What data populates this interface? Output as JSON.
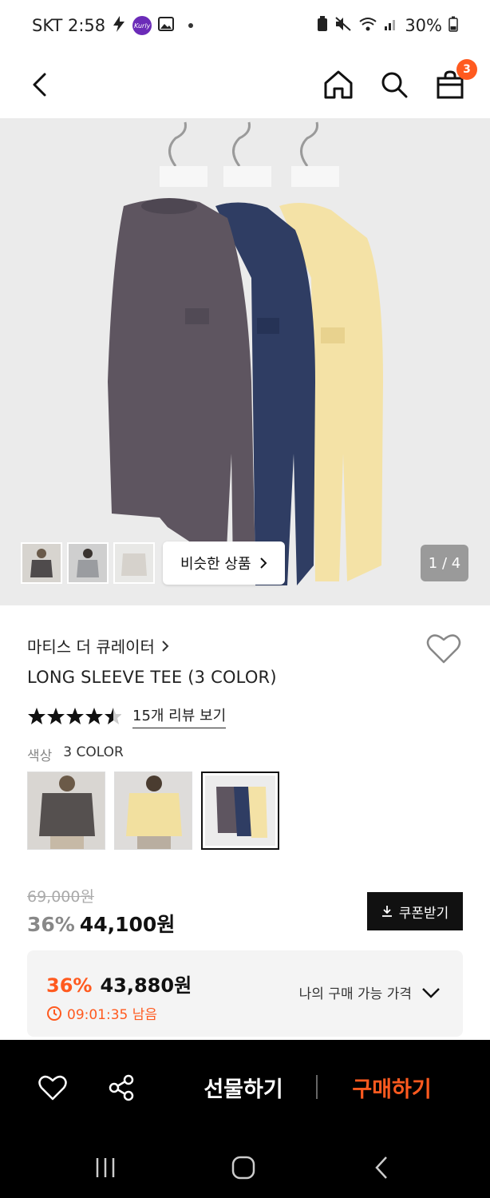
{
  "status_bar": {
    "carrier_time": "SKT 2:58",
    "kurly_label": "Kurly",
    "battery": "30%"
  },
  "nav": {
    "cart_count": "3"
  },
  "hero": {
    "similar_label": "비슷한 상품",
    "page_indicator": "1 / 4"
  },
  "product": {
    "brand": "마티스 더 큐레이터",
    "name": "LONG SLEEVE TEE (3 COLOR)",
    "rating_value": 4.5,
    "review_link": "15개 리뷰 보기",
    "color_label": "색상",
    "color_value": "3 COLOR"
  },
  "price": {
    "original": "69,000원",
    "discount": "36%",
    "sale": "44,100원",
    "coupon_label": "쿠폰받기"
  },
  "deal": {
    "discount": "36%",
    "amount": "43,880원",
    "timer": "09:01:35 남음",
    "dropdown_label": "나의 구매 가능 가격"
  },
  "actions": {
    "gift_label": "선물하기",
    "buy_label": "구매하기"
  },
  "colors": {
    "accent": "#ff5a1f",
    "dark": "#111111",
    "purple_shirt": "#5e5560",
    "navy_shirt": "#2f3d63",
    "yellow_shirt": "#f4e2a6"
  }
}
